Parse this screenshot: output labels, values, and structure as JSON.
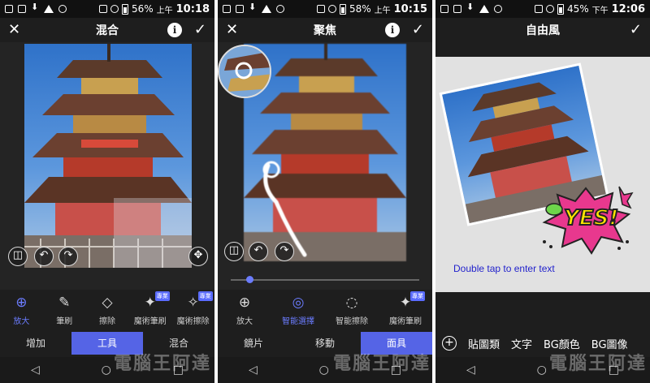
{
  "status_bars": [
    {
      "battery": "56%",
      "ampm": "上午",
      "time": "10:18"
    },
    {
      "battery": "58%",
      "ampm": "上午",
      "time": "10:15"
    },
    {
      "battery": "45%",
      "ampm": "下午",
      "time": "12:06"
    }
  ],
  "panel1": {
    "title": "混合",
    "tools": [
      {
        "label": "放大",
        "icon": "zoom-icon",
        "active": true
      },
      {
        "label": "筆刷",
        "icon": "brush-icon",
        "active": false
      },
      {
        "label": "擦除",
        "icon": "eraser-icon",
        "active": false
      },
      {
        "label": "魔術筆刷",
        "icon": "magic-brush-icon",
        "badge": "專業",
        "active": false
      },
      {
        "label": "魔術擦除",
        "icon": "magic-eraser-icon",
        "badge": "專業",
        "active": false
      }
    ],
    "tabs": [
      {
        "label": "增加",
        "active": false
      },
      {
        "label": "工具",
        "active": true
      },
      {
        "label": "混合",
        "active": false
      }
    ]
  },
  "panel2": {
    "title": "聚焦",
    "slider_value": 0.1,
    "tools": [
      {
        "label": "放大",
        "icon": "zoom-icon",
        "active": false
      },
      {
        "label": "智能選擇",
        "icon": "smart-select-icon",
        "active": true
      },
      {
        "label": "智能擦除",
        "icon": "smart-erase-icon",
        "active": false
      },
      {
        "label": "魔術筆刷",
        "icon": "magic-brush-icon",
        "badge": "專業",
        "active": false
      }
    ],
    "tabs": [
      {
        "label": "鏡片",
        "active": false
      },
      {
        "label": "移動",
        "active": false
      },
      {
        "label": "面具",
        "active": true
      }
    ]
  },
  "panel3": {
    "title": "自由風",
    "hint": "Double tap to enter text",
    "sticker_text": "YES!",
    "tools": [
      "貼圖類",
      "文字",
      "BG顏色",
      "BG圖像"
    ]
  },
  "watermark": "電腦王阿達",
  "colors": {
    "accent": "#5564e6",
    "active_icon": "#6b7cff",
    "hint_text": "#2222cc"
  }
}
